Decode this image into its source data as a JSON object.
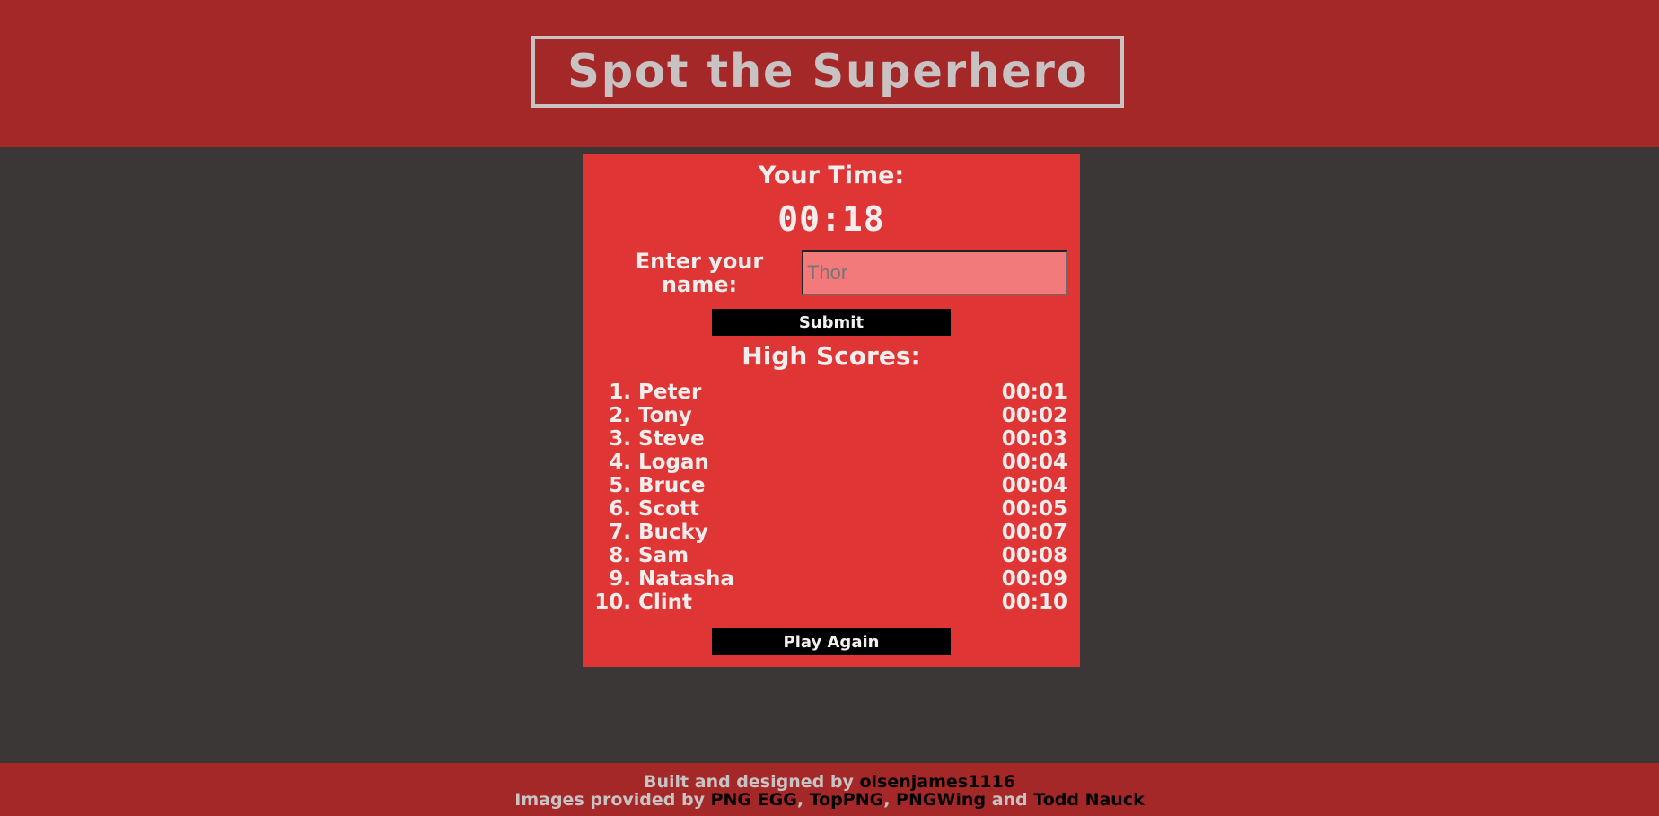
{
  "header": {
    "title": "Spot the Superhero"
  },
  "result": {
    "your_time_label": "Your Time:",
    "time": "00:18",
    "name_label": "Enter your name:",
    "name_placeholder": "Thor",
    "submit_label": "Submit"
  },
  "high_scores": {
    "title": "High Scores:",
    "entries": [
      {
        "rank": "1.",
        "name": "Peter",
        "time": "00:01"
      },
      {
        "rank": "2.",
        "name": "Tony",
        "time": "00:02"
      },
      {
        "rank": "3.",
        "name": "Steve",
        "time": "00:03"
      },
      {
        "rank": "4.",
        "name": "Logan",
        "time": "00:04"
      },
      {
        "rank": "5.",
        "name": "Bruce",
        "time": "00:04"
      },
      {
        "rank": "6.",
        "name": "Scott",
        "time": "00:05"
      },
      {
        "rank": "7.",
        "name": "Bucky",
        "time": "00:07"
      },
      {
        "rank": "8.",
        "name": "Sam",
        "time": "00:08"
      },
      {
        "rank": "9.",
        "name": "Natasha",
        "time": "00:09"
      },
      {
        "rank": "10.",
        "name": "Clint",
        "time": "00:10"
      }
    ],
    "play_again_label": "Play Again"
  },
  "footer": {
    "built_by_text": "Built and designed by",
    "author": "olsenjames1116",
    "images_text": "Images provided by",
    "source_1": "PNG EGG",
    "source_2": "TopPNG",
    "source_3": "PNGWing",
    "and_text": "and",
    "source_4": "Todd Nauck",
    "comma": ","
  },
  "colors": {
    "header_bg": "#a52828",
    "page_bg": "#3b3737",
    "panel_bg": "#e03535",
    "input_bg": "#f27a7a",
    "title_color": "#c8c2c2"
  }
}
